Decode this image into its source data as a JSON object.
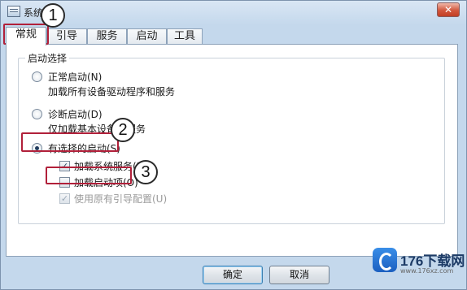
{
  "window": {
    "title": "系统配置"
  },
  "tabs": [
    {
      "label": "常规",
      "active": true
    },
    {
      "label": "引导",
      "active": false
    },
    {
      "label": "服务",
      "active": false
    },
    {
      "label": "启动",
      "active": false
    },
    {
      "label": "工具",
      "active": false
    }
  ],
  "startup_group": {
    "title": "启动选择",
    "normal": {
      "label": "正常启动(N)",
      "desc": "加载所有设备驱动程序和服务",
      "checked": false
    },
    "diagnostic": {
      "label": "诊断启动(D)",
      "desc": "仅加载基本设备和服务",
      "checked": false
    },
    "selective": {
      "label": "有选择的启动(S)",
      "checked": true
    },
    "load_services": {
      "label": "加载系统服务(L)",
      "checked": true
    },
    "load_startup": {
      "label": "加载启动项(O)",
      "checked": false
    },
    "use_original_boot": {
      "label": "使用原有引导配置(U)",
      "checked": true,
      "disabled": true
    }
  },
  "buttons": {
    "ok": "确定",
    "cancel": "取消"
  },
  "annotations": {
    "step1": "1",
    "step2": "2",
    "step3": "3"
  },
  "watermark": {
    "text": "176下载网",
    "sub": "www.176xz.com"
  },
  "colors": {
    "marker": "#b1203a",
    "accent": "#3c7fb1"
  }
}
